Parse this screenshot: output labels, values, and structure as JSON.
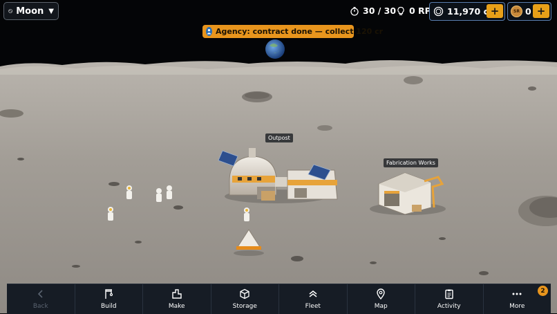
{
  "location": {
    "name": "Moon",
    "icon": "globe-icon"
  },
  "resources": {
    "energy": "30 / 30",
    "research": "0 RP",
    "credits": "11,970 cr",
    "sr": "0"
  },
  "notification": {
    "text": "Agency: contract done — collect 120 cr",
    "icon": "agency-icon"
  },
  "labels": {
    "outpost": "Outpost",
    "fabrication": "Fabrication Works"
  },
  "sr_coin_label": "SR",
  "nav": {
    "items": [
      {
        "label": "Back",
        "icon": "back-icon",
        "enabled": false
      },
      {
        "label": "Build",
        "icon": "build-icon"
      },
      {
        "label": "Make",
        "icon": "make-icon"
      },
      {
        "label": "Storage",
        "icon": "storage-icon"
      },
      {
        "label": "Fleet",
        "icon": "fleet-icon"
      },
      {
        "label": "Map",
        "icon": "map-icon"
      },
      {
        "label": "Activity",
        "icon": "activity-icon"
      },
      {
        "label": "More",
        "icon": "more-icon"
      }
    ],
    "more_badge": "2"
  },
  "colors": {
    "accent": "#e8951d",
    "panel": "#161c25",
    "border": "#5a7fb0"
  }
}
